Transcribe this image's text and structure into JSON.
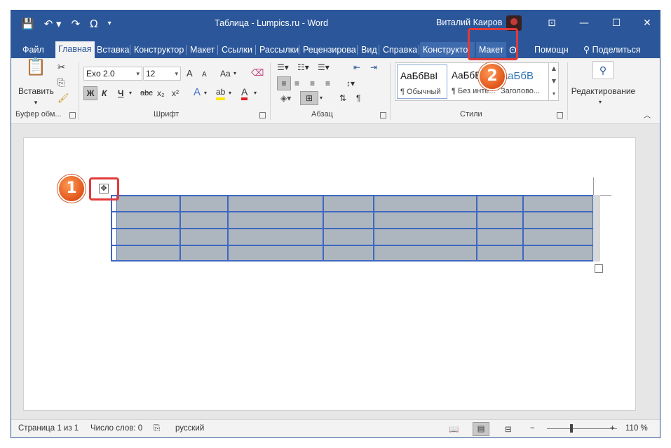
{
  "titlebar": {
    "qat": [
      "💾",
      "↶ ▾",
      "↷",
      "Ω",
      "▾"
    ],
    "title": "Таблица - Lumpics.ru  -  Word",
    "user": "Виталий Каиров",
    "buttons": [
      "⊡",
      "—",
      "☐",
      "✕"
    ]
  },
  "tabs": [
    "Файл",
    "Главная",
    "Вставка",
    "Конструктор",
    "Макет",
    "Ссылки",
    "Рассылки",
    "Рецензирова",
    "Вид",
    "Справка",
    "Конструкто",
    "Макет",
    "Помощн",
    "Поделиться"
  ],
  "ribbon": {
    "clipboard": {
      "paste_label": "Вставить",
      "group": "Буфер обм..."
    },
    "font": {
      "font_name": "Exo 2.0",
      "font_size": "12",
      "bold": "Ж",
      "italic": "К",
      "underline": "Ч",
      "strike": "abc",
      "sub": "x₂",
      "sup": "x²",
      "grow": "A",
      "shrink": "A",
      "case": "Aa",
      "effects": "A",
      "highlight": "ab",
      "color": "A",
      "group": "Шрифт"
    },
    "paragraph": {
      "group": "Абзац",
      "pilcrow": "¶"
    },
    "styles": {
      "items": [
        {
          "sample": "АаБбВвI",
          "name": "¶ Обычный"
        },
        {
          "sample": "АаБбВвI",
          "name": "¶ Без инте..."
        },
        {
          "sample": "АаБбВ",
          "name": "Заголово..."
        }
      ],
      "group": "Стили"
    },
    "editing": {
      "label": "Редактирование"
    }
  },
  "statusbar": {
    "page": "Страница 1 из 1",
    "words": "Число слов: 0",
    "lang": "русский",
    "zoom": "110 %"
  },
  "callouts": {
    "one": "1",
    "two": "2"
  },
  "colors": {
    "accent": "#2b579a",
    "callout": "#e0551a",
    "highlight_box": "#e03a3a",
    "table_border": "#3e68bf",
    "table_fill": "#adb5bf"
  }
}
